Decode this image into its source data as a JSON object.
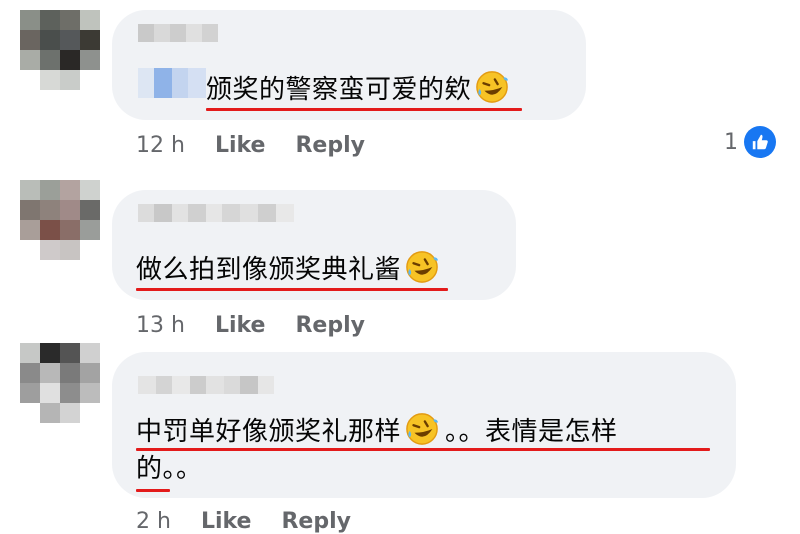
{
  "comments": [
    {
      "text": "颁奖的警察蛮可爱的欸",
      "emoji": "rolling-on-floor-laughing",
      "time": "12 h",
      "like_label": "Like",
      "reply_label": "Reply",
      "reaction_count": "1",
      "reaction_type": "like-icon"
    },
    {
      "text": "做么拍到像颁奖典礼酱",
      "emoji": "rolling-on-floor-laughing",
      "time": "13 h",
      "like_label": "Like",
      "reply_label": "Reply"
    },
    {
      "text_line1": "中罚单好像颁奖礼那样",
      "text_line1_tail": "。。表情是怎样",
      "text_line2": "的。。",
      "emoji": "rolling-on-floor-laughing",
      "time": "2 h",
      "like_label": "Like",
      "reply_label": "Reply"
    }
  ],
  "colors": {
    "bubble": "#f0f2f5",
    "underline": "#e31b1b",
    "meta_text": "#65676b",
    "like_blue": "#1877f2"
  }
}
